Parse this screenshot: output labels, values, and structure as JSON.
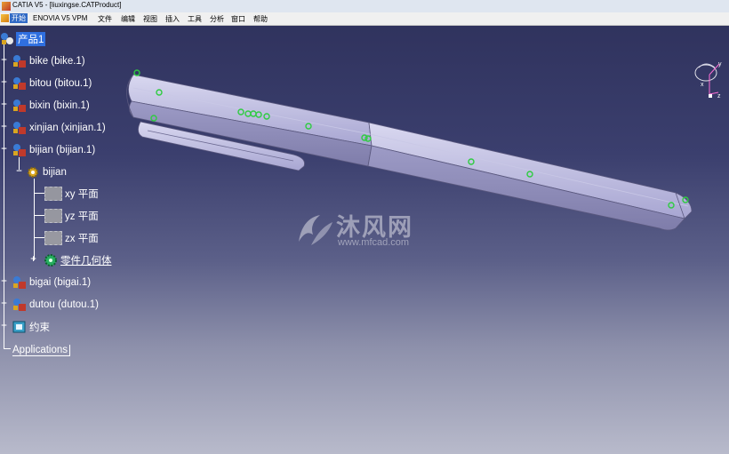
{
  "window": {
    "title": "CATIA V5 - [liuxingse.CATProduct]"
  },
  "menu": [
    {
      "label": "开始",
      "active": true
    },
    {
      "label": "ENOVIA V5 VPM",
      "active": false
    },
    {
      "label": "文件",
      "active": false
    },
    {
      "label": "编辑",
      "active": false
    },
    {
      "label": "视图",
      "active": false
    },
    {
      "label": "插入",
      "active": false
    },
    {
      "label": "工具",
      "active": false
    },
    {
      "label": "分析",
      "active": false
    },
    {
      "label": "窗口",
      "active": false
    },
    {
      "label": "帮助",
      "active": false
    }
  ],
  "tree": {
    "root": "产品1",
    "nodes": [
      {
        "label": "bike (bike.1)",
        "icon": "part-icon"
      },
      {
        "label": "bitou (bitou.1)",
        "icon": "part-icon"
      },
      {
        "label": "bixin (bixin.1)",
        "icon": "part-icon"
      },
      {
        "label": "xinjian (xinjian.1)",
        "icon": "part-icon"
      },
      {
        "label": "bijian (bijian.1)",
        "icon": "part-icon"
      },
      {
        "label": "bijian",
        "icon": "gear-icon"
      },
      {
        "label": "xy 平面",
        "icon": "plane-icon"
      },
      {
        "label": "yz 平面",
        "icon": "plane-icon"
      },
      {
        "label": "zx 平面",
        "icon": "plane-icon"
      },
      {
        "label": "零件几何体",
        "icon": "body-gear-icon"
      },
      {
        "label": "bigai (bigai.1)",
        "icon": "part-icon"
      },
      {
        "label": "dutou (dutou.1)",
        "icon": "part-icon"
      },
      {
        "label": "约束",
        "icon": "constraints-icon"
      },
      {
        "label": "Applications",
        "icon": ""
      }
    ]
  },
  "watermark": {
    "brand": "沐风网",
    "url": "www.mfcad.com"
  },
  "compass": {
    "axis_x": "x",
    "axis_y": "y",
    "axis_z": "z"
  },
  "colors": {
    "selected": "#2f6fe0",
    "model": "#a6a4cf",
    "constraint_marker": "#2ecc40"
  }
}
